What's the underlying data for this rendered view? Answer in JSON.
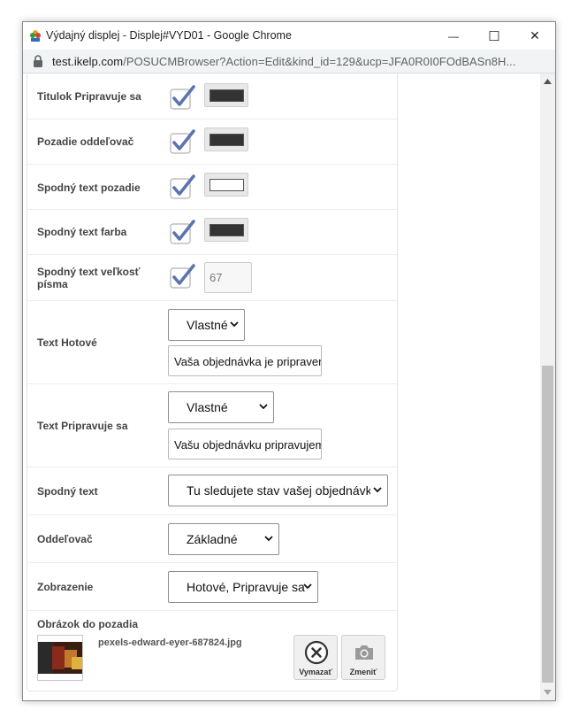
{
  "window": {
    "title": "Výdajný displej - Displej#VYD01 - Google Chrome",
    "minimize_glyph": "—",
    "maximize_glyph": "☐",
    "close_glyph": "✕"
  },
  "address_bar": {
    "host": "test.ikelp.com",
    "path": "/POSUCMBrowser?Action=Edit&kind_id=129&ucp=JFA0R0I0FOdBASn8H..."
  },
  "form": {
    "rows": [
      {
        "label": "Titulok Pripravuje sa",
        "checked": true,
        "color": "#333333"
      },
      {
        "label": "Pozadie oddeľovač",
        "checked": true,
        "color": "#333333"
      },
      {
        "label": "Spodný text pozadie",
        "checked": true,
        "color": "#ffffff"
      },
      {
        "label": "Spodný text farba",
        "checked": true,
        "color": "#333333"
      },
      {
        "label": "Spodný text veľkosť písma",
        "checked": true,
        "value": "67"
      }
    ],
    "text_hotove": {
      "label": "Text Hotové",
      "select_value": "Vlastné",
      "input_value": "Vaša objednávka je pripravená"
    },
    "text_pripravuje": {
      "label": "Text Pripravuje sa",
      "select_value": "Vlastné",
      "input_value": "Vašu objednávku pripravujeme"
    },
    "spodny_text": {
      "label": "Spodný text",
      "select_value": "Tu sledujete stav vašej objednávky"
    },
    "oddelovac": {
      "label": "Oddeľovač",
      "select_value": "Základné"
    },
    "zobrazenie": {
      "label": "Zobrazenie",
      "select_value": "Hotové, Pripravuje sa"
    },
    "background_image": {
      "label": "Obrázok do pozadia",
      "filename": "pexels-edward-eyer-687824.jpg",
      "delete_label": "Vymazať",
      "change_label": "Zmeniť"
    }
  },
  "colors": {
    "check_accent": "#5b73b0",
    "label_text": "#444444",
    "scroll_thumb": "#c1c1c1"
  }
}
